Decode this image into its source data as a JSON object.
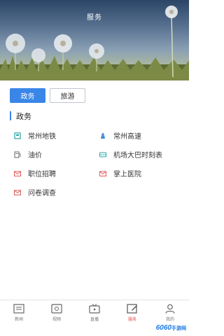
{
  "header": {
    "title": "服务"
  },
  "tabs": [
    {
      "label": "政务",
      "active": true
    },
    {
      "label": "旅游",
      "active": false
    }
  ],
  "section": {
    "title": "政务"
  },
  "services": [
    {
      "label": "常州地铁",
      "icon": "metro-icon"
    },
    {
      "label": "常州高速",
      "icon": "highway-icon"
    },
    {
      "label": "油价",
      "icon": "fuel-icon"
    },
    {
      "label": "机场大巴时刻表",
      "icon": "bus-icon"
    },
    {
      "label": "职位招聘",
      "icon": "mail-icon"
    },
    {
      "label": "掌上医院",
      "icon": "hospital-icon"
    },
    {
      "label": "问卷调查",
      "icon": "survey-icon"
    }
  ],
  "nav": [
    {
      "label": "新闻",
      "icon": "news-icon",
      "active": false
    },
    {
      "label": "视频",
      "icon": "video-icon",
      "active": false
    },
    {
      "label": "直播",
      "icon": "tv-icon",
      "active": false
    },
    {
      "label": "服务",
      "icon": "edit-icon",
      "active": true
    },
    {
      "label": "我的",
      "icon": "user-icon",
      "active": false
    }
  ],
  "watermark": {
    "part1": "6060",
    "part2": "手游网"
  },
  "colors": {
    "accent": "#3a86e8",
    "active_nav": "#e24b4b",
    "icon_red": "#e25b5b",
    "icon_teal": "#2aa3a0"
  }
}
